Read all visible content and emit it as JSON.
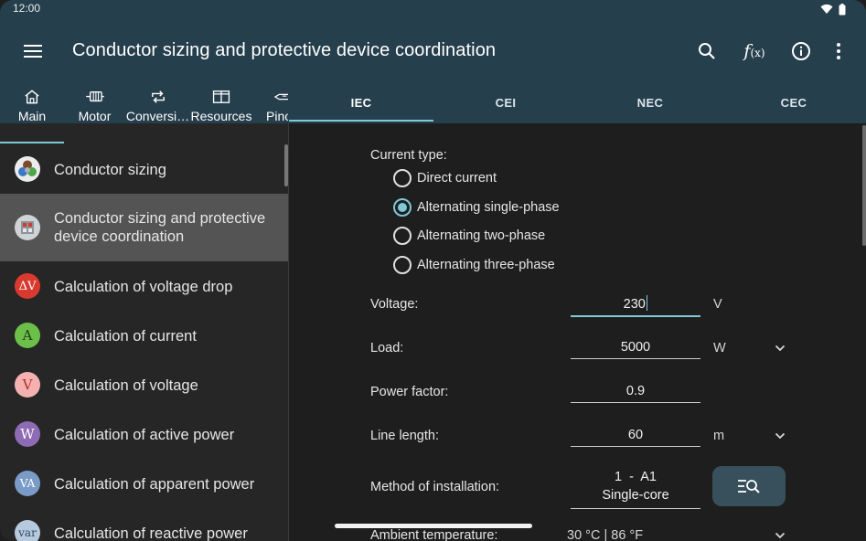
{
  "status": {
    "time": "12:00"
  },
  "app": {
    "title": "Conductor sizing and protective device coordination"
  },
  "actions": [
    {
      "name": "search-icon"
    },
    {
      "name": "function-icon",
      "label": "f",
      "sub": "(x)"
    },
    {
      "name": "info-icon"
    },
    {
      "name": "more-vert-icon"
    }
  ],
  "left_tabs": [
    {
      "label": "Main",
      "icon": "home-icon",
      "active": true
    },
    {
      "label": "Motor",
      "icon": "motor-icon"
    },
    {
      "label": "Conversi…",
      "icon": "repeat-icon"
    },
    {
      "label": "Resources",
      "icon": "book-icon"
    },
    {
      "label": "Pino",
      "icon": "plug-icon"
    }
  ],
  "std_tabs": [
    {
      "label": "IEC",
      "active": true
    },
    {
      "label": "CEI"
    },
    {
      "label": "NEC"
    },
    {
      "label": "CEC"
    }
  ],
  "list": [
    {
      "label": "Conductor sizing",
      "icon": "conductor-cores-icon"
    },
    {
      "label": "Conductor sizing and protective device coordination",
      "icon": "breaker-icon",
      "selected": true
    },
    {
      "label": "Calculation of voltage drop",
      "icon": "voltage-drop-icon",
      "glyph": "ΔV",
      "bg": "#d93a2f",
      "fg": "#ffffff"
    },
    {
      "label": "Calculation of current",
      "icon": "current-icon",
      "glyph": "A",
      "bg": "#6cc04a",
      "fg": "#1f3a12"
    },
    {
      "label": "Calculation of voltage",
      "icon": "voltage-icon",
      "glyph": "V",
      "bg": "#f4b1b0",
      "fg": "#b0302a"
    },
    {
      "label": "Calculation of active power",
      "icon": "active-power-icon",
      "glyph": "W",
      "bg": "#8e6bb5",
      "fg": "#ffffff"
    },
    {
      "label": "Calculation of apparent power",
      "icon": "apparent-power-icon",
      "glyph": "VA",
      "bg": "#7a9bc8",
      "fg": "#ffffff"
    },
    {
      "label": "Calculation of reactive power",
      "icon": "reactive-power-icon",
      "glyph": "var",
      "bg": "#b7c9dd",
      "fg": "#2d4a6a"
    }
  ],
  "form": {
    "current_type_label": "Current type:",
    "current_types": [
      {
        "label": "Direct current",
        "checked": false
      },
      {
        "label": "Alternating single-phase",
        "checked": true
      },
      {
        "label": "Alternating two-phase",
        "checked": false
      },
      {
        "label": "Alternating three-phase",
        "checked": false
      }
    ],
    "voltage": {
      "label": "Voltage:",
      "value": "230",
      "unit": "V"
    },
    "load": {
      "label": "Load:",
      "value": "5000",
      "unit": "W"
    },
    "power_factor": {
      "label": "Power factor:",
      "value": "0.9"
    },
    "line_length": {
      "label": "Line length:",
      "value": "60",
      "unit": "m"
    },
    "installation": {
      "label": "Method of installation:",
      "value_line1": "1  -  A1",
      "value_line2": "Single-core"
    },
    "ambient": {
      "label": "Ambient temperature:",
      "value": "30 °C | 86 °F"
    }
  },
  "colors": {
    "appbar": "#263f4d",
    "accent": "#7fc7d9",
    "selected_row": "#545454"
  }
}
